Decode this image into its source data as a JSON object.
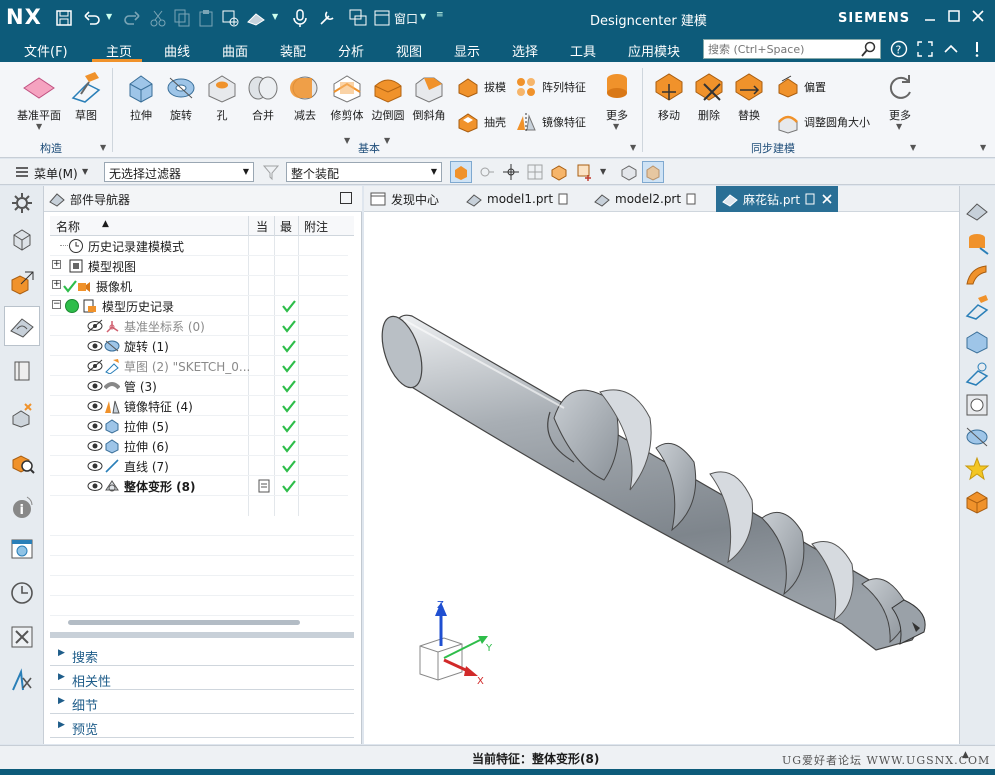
{
  "titlebar": {
    "logo": "NX",
    "window_menu": "窗口",
    "app_title": "Designcenter 建模",
    "brand": "SIEMENS"
  },
  "menubar": {
    "items": [
      "文件(F)",
      "主页",
      "曲线",
      "曲面",
      "装配",
      "分析",
      "视图",
      "显示",
      "选择",
      "工具",
      "应用模块"
    ],
    "active": "主页",
    "search_placeholder": "搜索 (Ctrl+Space)"
  },
  "ribbon": {
    "construct": {
      "label": "构造",
      "buttons": [
        "基准平面",
        "草图"
      ]
    },
    "basic": {
      "label": "基本",
      "buttons": [
        "拉伸",
        "旋转",
        "孔",
        "合并",
        "减去",
        "修剪体",
        "边倒圆",
        "倒斜角"
      ],
      "small": [
        "拔模",
        "阵列特征",
        "抽壳",
        "镜像特征"
      ],
      "more": "更多"
    },
    "sync": {
      "label": "同步建模",
      "buttons": [
        "移动",
        "删除",
        "替换"
      ],
      "small": [
        "偏置",
        "调整圆角大小"
      ],
      "more": "更多"
    }
  },
  "filterbar": {
    "menu": "菜单(M)",
    "filter": "无选择过滤器",
    "scope": "整个装配"
  },
  "navigator": {
    "title": "部件导航器",
    "columns": [
      "名称",
      "当",
      "最",
      "附注"
    ],
    "rows": [
      {
        "label": "历史记录建模模式",
        "state": "normal"
      },
      {
        "label": "模型视图",
        "state": "normal"
      },
      {
        "label": "摄像机",
        "state": "normal"
      },
      {
        "label": "模型历史记录",
        "state": "normal"
      },
      {
        "label": "基准坐标系 (0)",
        "state": "gray"
      },
      {
        "label": "旋转 (1)",
        "state": "normal"
      },
      {
        "label": "草图 (2) \"SKETCH_0...",
        "state": "gray"
      },
      {
        "label": "管 (3)",
        "state": "normal"
      },
      {
        "label": "镜像特征 (4)",
        "state": "normal"
      },
      {
        "label": "拉伸 (5)",
        "state": "normal"
      },
      {
        "label": "拉伸 (6)",
        "state": "normal"
      },
      {
        "label": "直线 (7)",
        "state": "normal"
      },
      {
        "label": "整体变形 (8)",
        "state": "bold"
      }
    ],
    "panels": [
      "搜索",
      "相关性",
      "细节",
      "预览"
    ]
  },
  "tabs": [
    "发现中心",
    "model1.prt",
    "model2.prt",
    "麻花钻.prt"
  ],
  "active_tab": "麻花钻.prt",
  "triad": {
    "z": "Z",
    "y": "Y",
    "x": "X"
  },
  "status": {
    "text": "当前特征：整体变形(8)",
    "watermark": "UG爱好者论坛 WWW.UGSNX.COM"
  },
  "colors": {
    "titlebar": "#0d5b7a",
    "check": "#2ebd4a",
    "accent_orange": "#f0922b"
  }
}
